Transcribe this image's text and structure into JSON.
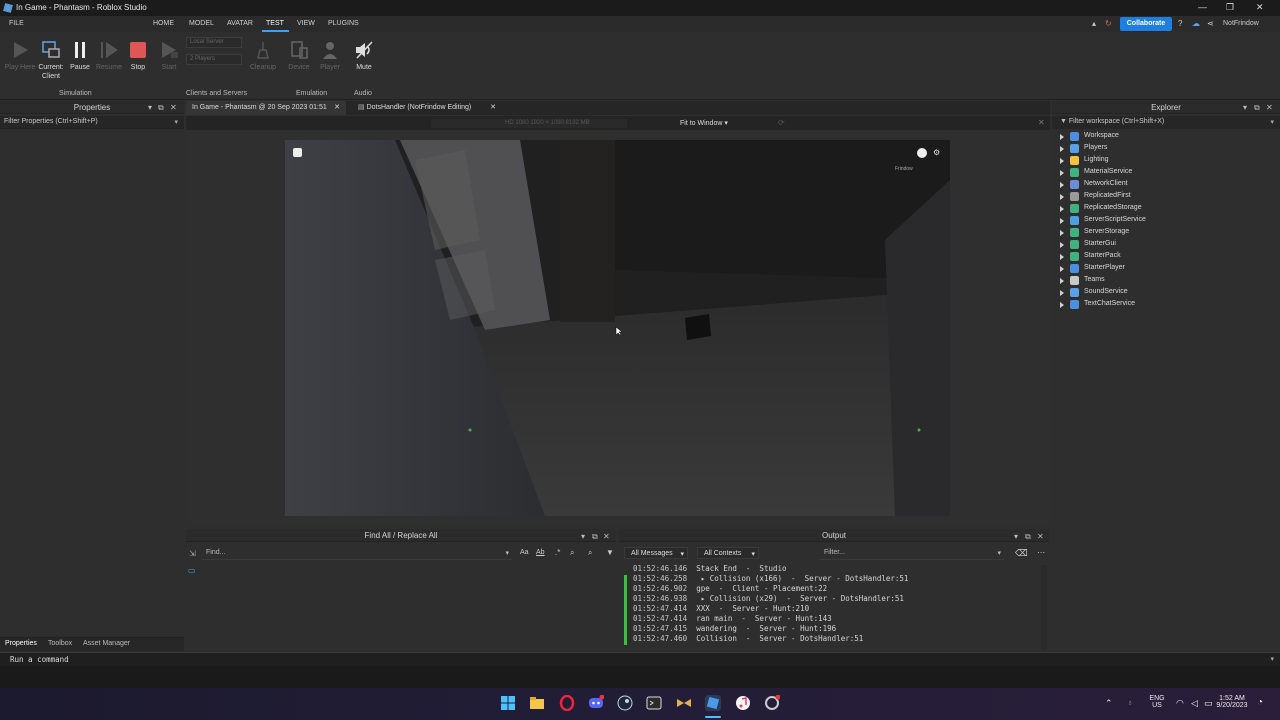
{
  "window": {
    "title": "In Game - Phantasm - Roblox Studio",
    "min": "—",
    "restore": "❐",
    "close": "✕"
  },
  "menu": {
    "file": "FILE",
    "home": "HOME",
    "model": "MODEL",
    "avatar": "AVATAR",
    "test": "TEST",
    "view": "VIEW",
    "plugins": "PLUGINS"
  },
  "topbar": {
    "collaborate": "Collaborate",
    "username": "NotFrindow"
  },
  "ribbon": {
    "play_here": "Play Here",
    "current_client": "Current: Client",
    "pause": "Pause",
    "resume": "Resume",
    "stop": "Stop",
    "start": "Start",
    "local_server": "Local Server",
    "players_count": "2 Players",
    "cleanup": "Cleanup",
    "device": "Device",
    "player": "Player",
    "mute": "Mute",
    "groups": {
      "simulation": "Simulation",
      "clients_servers": "Clients and Servers",
      "emulation": "Emulation",
      "audio": "Audio"
    }
  },
  "properties": {
    "title": "Properties",
    "filter": "Filter Properties (Ctrl+Shift+P)"
  },
  "doc_tabs": [
    {
      "label": "In Game - Phantasm @ 20 Sep 2023 01:51"
    },
    {
      "label": "DotsHandler (NotFrindow Editing)"
    }
  ],
  "viewport": {
    "res_info": "HD 1080   1920 × 1080   8192 MB",
    "fit": "Fit to Window ▾",
    "game_label": "Frindow"
  },
  "explorer": {
    "title": "Explorer",
    "filter": "Filter workspace (Ctrl+Shift+X)",
    "items": [
      {
        "label": "Workspace",
        "color": "#4a8fe0"
      },
      {
        "label": "Players",
        "color": "#5aa0e8"
      },
      {
        "label": "Lighting",
        "color": "#f2c43b"
      },
      {
        "label": "MaterialService",
        "color": "#3fb27f"
      },
      {
        "label": "NetworkClient",
        "color": "#6c8cd5"
      },
      {
        "label": "ReplicatedFirst",
        "color": "#9a9a9a"
      },
      {
        "label": "ReplicatedStorage",
        "color": "#3fb27f"
      },
      {
        "label": "ServerScriptService",
        "color": "#4aa3e0"
      },
      {
        "label": "ServerStorage",
        "color": "#3fb27f"
      },
      {
        "label": "StarterGui",
        "color": "#3fb27f"
      },
      {
        "label": "StarterPack",
        "color": "#3fb27f"
      },
      {
        "label": "StarterPlayer",
        "color": "#4a8fe0"
      },
      {
        "label": "Teams",
        "color": "#c9c9c9"
      },
      {
        "label": "SoundService",
        "color": "#5aa0e8"
      },
      {
        "label": "TextChatService",
        "color": "#4a8fe0"
      }
    ]
  },
  "find": {
    "title": "Find All / Replace All",
    "placeholder": "Find...",
    "aa": "Aa",
    "ab": "Ab"
  },
  "output": {
    "title": "Output",
    "all_messages": "All Messages",
    "all_contexts": "All Contexts",
    "filter": "Filter...",
    "lines": [
      {
        "ts": "01:52:46.146",
        "msg": "Stack End  -  Studio"
      },
      {
        "ts": "01:52:46.258",
        "msg": " ▸ Collision (x166)  -  Server - DotsHandler:51"
      },
      {
        "ts": "01:52:46.902",
        "msg": "gpe  -  Client - Placement:22"
      },
      {
        "ts": "01:52:46.938",
        "msg": " ▸ Collision (x29)  -  Server - DotsHandler:51"
      },
      {
        "ts": "01:52:47.414",
        "msg": "XXX  -  Server - Hunt:210"
      },
      {
        "ts": "01:52:47.414",
        "msg": "ran main  -  Server - Hunt:143"
      },
      {
        "ts": "01:52:47.415",
        "msg": "wandering  -  Server - Hunt:196"
      },
      {
        "ts": "01:52:47.460",
        "msg": "Collision  -  Server - DotsHandler:51"
      }
    ]
  },
  "bottom_tabs": {
    "properties": "Properties",
    "toolbox": "Toolbox",
    "asset_manager": "Asset Manager"
  },
  "command": {
    "placeholder": "Run a command"
  },
  "tray": {
    "lang": "ENG",
    "region": "US",
    "time": "1:52 AM",
    "date": "9/20/2023"
  },
  "colors": {
    "accent": "#1e7fe0",
    "stop_red": "#e05555"
  }
}
